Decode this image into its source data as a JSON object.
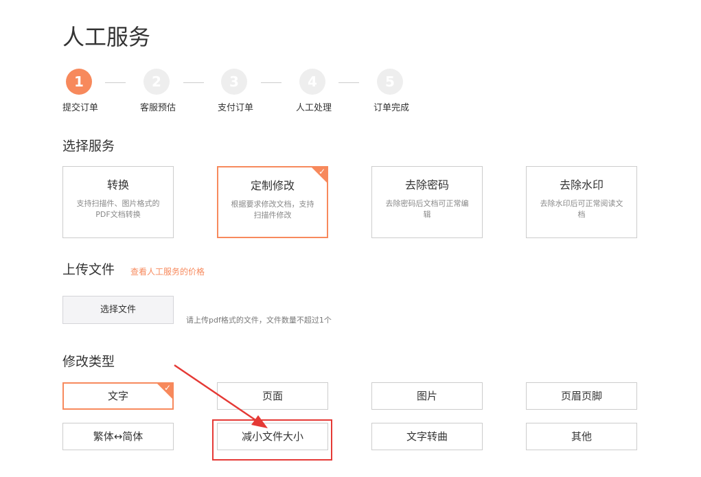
{
  "page": {
    "title": "人工服务"
  },
  "steps": [
    {
      "number": "1",
      "label": "提交订单",
      "active": true
    },
    {
      "number": "2",
      "label": "客服预估",
      "active": false
    },
    {
      "number": "3",
      "label": "支付订单",
      "active": false
    },
    {
      "number": "4",
      "label": "人工处理",
      "active": false
    },
    {
      "number": "5",
      "label": "订单完成",
      "active": false
    }
  ],
  "select_service": {
    "title": "选择服务",
    "cards": [
      {
        "title": "转换",
        "desc": "支持扫描件、图片格式的PDF文档转换",
        "selected": false
      },
      {
        "title": "定制修改",
        "desc": "根据要求修改文档，支持扫描件修改",
        "selected": true
      },
      {
        "title": "去除密码",
        "desc": "去除密码后文档可正常编辑",
        "selected": false
      },
      {
        "title": "去除水印",
        "desc": "去除水印后可正常阅读文档",
        "selected": false
      }
    ]
  },
  "upload": {
    "title": "上传文件",
    "price_link": "查看人工服务的价格",
    "button_label": "选择文件",
    "hint": "请上传pdf格式的文件，文件数量不超过1个"
  },
  "modify_type": {
    "title": "修改类型",
    "options": [
      {
        "label": "文字",
        "selected": true
      },
      {
        "label": "页面",
        "selected": false
      },
      {
        "label": "图片",
        "selected": false
      },
      {
        "label": "页眉页脚",
        "selected": false
      },
      {
        "label": "繁体↔简体",
        "selected": false
      },
      {
        "label": "减小文件大小",
        "selected": false
      },
      {
        "label": "文字转曲",
        "selected": false
      },
      {
        "label": "其他",
        "selected": false
      }
    ]
  },
  "colors": {
    "accent": "#f7895c",
    "annotation": "#e53935",
    "inactive_step": "#eeeeee"
  },
  "icons": {
    "check": "check-icon"
  }
}
